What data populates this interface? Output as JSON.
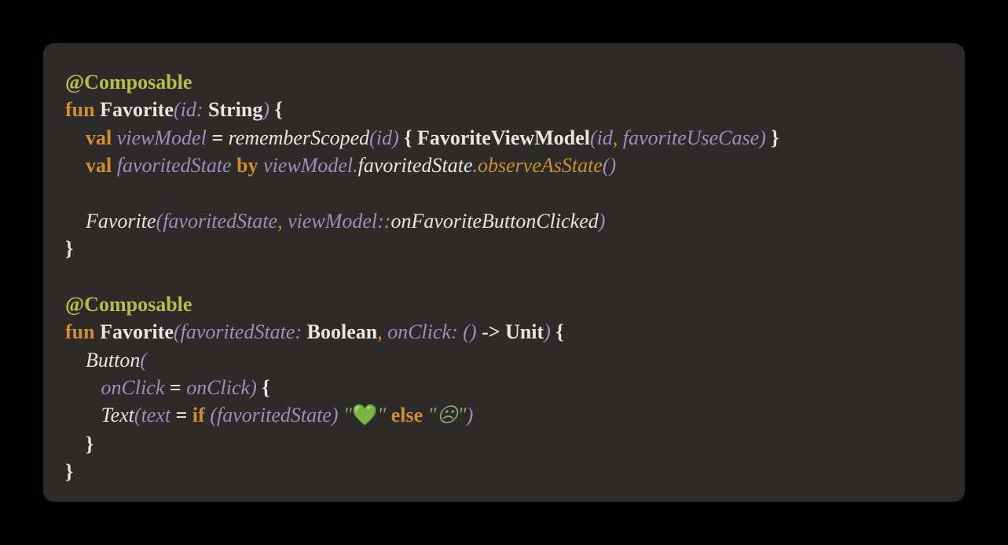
{
  "colors": {
    "background": "#000000",
    "card": "#2c2b2a",
    "annotation": "#b7bd46",
    "keyword": "#d28e2d",
    "text": "#e8e5dc",
    "identifier": "#9e8eb8",
    "string": "#89a86a"
  },
  "language": "Kotlin",
  "code": {
    "tokens": [
      [
        {
          "t": "@Composable",
          "c": "annotation"
        }
      ],
      [
        {
          "t": "fun ",
          "c": "keyword"
        },
        {
          "t": "Favorite",
          "c": "funcname"
        },
        {
          "t": "(",
          "c": "punc"
        },
        {
          "t": "id",
          "c": "param"
        },
        {
          "t": ": ",
          "c": "punc"
        },
        {
          "t": "String",
          "c": "type"
        },
        {
          "t": ")",
          "c": "punc"
        },
        {
          "t": " {",
          "c": "puncB"
        }
      ],
      [
        {
          "t": "    ",
          "c": "plain"
        },
        {
          "t": "val ",
          "c": "keyword"
        },
        {
          "t": "viewModel",
          "c": "ident"
        },
        {
          "t": " = ",
          "c": "op"
        },
        {
          "t": "rememberScoped",
          "c": "call"
        },
        {
          "t": "(",
          "c": "punc"
        },
        {
          "t": "id",
          "c": "ident"
        },
        {
          "t": ")",
          "c": "punc"
        },
        {
          "t": " { ",
          "c": "puncB"
        },
        {
          "t": "FavoriteViewModel",
          "c": "type"
        },
        {
          "t": "(",
          "c": "punc"
        },
        {
          "t": "id",
          "c": "ident"
        },
        {
          "t": ",",
          "c": "comma-o"
        },
        {
          "t": " ",
          "c": "plain"
        },
        {
          "t": "favoriteUseCase",
          "c": "ident"
        },
        {
          "t": ")",
          "c": "punc"
        },
        {
          "t": " }",
          "c": "puncB"
        }
      ],
      [
        {
          "t": "    ",
          "c": "plain"
        },
        {
          "t": "val ",
          "c": "keyword"
        },
        {
          "t": "favoritedState",
          "c": "ident"
        },
        {
          "t": " ",
          "c": "plain"
        },
        {
          "t": "by",
          "c": "keyword"
        },
        {
          "t": " ",
          "c": "plain"
        },
        {
          "t": "viewModel",
          "c": "ident"
        },
        {
          "t": ".",
          "c": "punc"
        },
        {
          "t": "favoritedState",
          "c": "call"
        },
        {
          "t": ".",
          "c": "punc"
        },
        {
          "t": "observeAsState",
          "c": "method"
        },
        {
          "t": "()",
          "c": "punc"
        }
      ],
      [
        {
          "t": " ",
          "c": "plain"
        }
      ],
      [
        {
          "t": "    ",
          "c": "plain"
        },
        {
          "t": "Favorite",
          "c": "call"
        },
        {
          "t": "(",
          "c": "punc"
        },
        {
          "t": "favoritedState",
          "c": "ident"
        },
        {
          "t": ",",
          "c": "comma-o"
        },
        {
          "t": " ",
          "c": "plain"
        },
        {
          "t": "viewModel",
          "c": "ident"
        },
        {
          "t": "::",
          "c": "punc"
        },
        {
          "t": "onFavoriteButtonClicked",
          "c": "call"
        },
        {
          "t": ")",
          "c": "punc"
        }
      ],
      [
        {
          "t": "}",
          "c": "puncB"
        }
      ],
      [
        {
          "t": " ",
          "c": "plain"
        }
      ],
      [
        {
          "t": "@Composable",
          "c": "annotation"
        }
      ],
      [
        {
          "t": "fun ",
          "c": "keyword"
        },
        {
          "t": "Favorite",
          "c": "funcname"
        },
        {
          "t": "(",
          "c": "punc"
        },
        {
          "t": "favoritedState",
          "c": "param"
        },
        {
          "t": ": ",
          "c": "punc"
        },
        {
          "t": "Boolean",
          "c": "type"
        },
        {
          "t": ",",
          "c": "comma-o"
        },
        {
          "t": " ",
          "c": "plain"
        },
        {
          "t": "onClick",
          "c": "param"
        },
        {
          "t": ": ",
          "c": "punc"
        },
        {
          "t": "()",
          "c": "punc"
        },
        {
          "t": " -> ",
          "c": "op"
        },
        {
          "t": "Unit",
          "c": "type"
        },
        {
          "t": ")",
          "c": "punc"
        },
        {
          "t": " {",
          "c": "puncB"
        }
      ],
      [
        {
          "t": "    ",
          "c": "plain"
        },
        {
          "t": "Button",
          "c": "call"
        },
        {
          "t": "(",
          "c": "punc"
        }
      ],
      [
        {
          "t": "       ",
          "c": "plain"
        },
        {
          "t": "onClick",
          "c": "ident"
        },
        {
          "t": " = ",
          "c": "op"
        },
        {
          "t": "onClick",
          "c": "ident"
        },
        {
          "t": ")",
          "c": "punc"
        },
        {
          "t": " {",
          "c": "puncB"
        }
      ],
      [
        {
          "t": "       ",
          "c": "plain"
        },
        {
          "t": "Text",
          "c": "call"
        },
        {
          "t": "(",
          "c": "punc"
        },
        {
          "t": "text",
          "c": "ident"
        },
        {
          "t": " = ",
          "c": "op"
        },
        {
          "t": "if ",
          "c": "keyword"
        },
        {
          "t": "(",
          "c": "punc"
        },
        {
          "t": "favoritedState",
          "c": "ident"
        },
        {
          "t": ")",
          "c": "punc"
        },
        {
          "t": " ",
          "c": "plain"
        },
        {
          "t": "\"",
          "c": "string"
        },
        {
          "t": "💚",
          "c": "emoji"
        },
        {
          "t": "\"",
          "c": "string"
        },
        {
          "t": " ",
          "c": "plain"
        },
        {
          "t": "else",
          "c": "keyword"
        },
        {
          "t": " ",
          "c": "plain"
        },
        {
          "t": "\"☹\"",
          "c": "string"
        },
        {
          "t": ")",
          "c": "punc"
        }
      ],
      [
        {
          "t": "    ",
          "c": "plain"
        },
        {
          "t": "}",
          "c": "puncB"
        }
      ],
      [
        {
          "t": "}",
          "c": "puncB"
        }
      ]
    ]
  }
}
